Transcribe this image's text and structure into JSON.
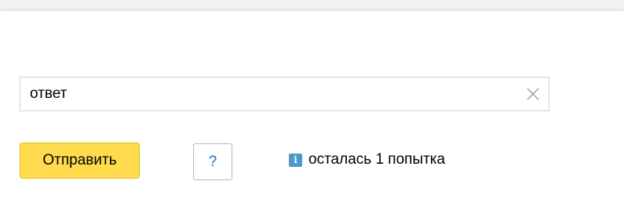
{
  "answer": {
    "value": "ответ",
    "clear_icon": "close-icon"
  },
  "actions": {
    "submit_label": "Отправить",
    "help_label": "?"
  },
  "status": {
    "info_icon_glyph": "i",
    "attempts_text": "осталась 1 попытка"
  },
  "colors": {
    "submit_bg": "#ffdb4d",
    "help_text": "#1f6fd0",
    "info_icon_bg": "#4f97c9"
  }
}
